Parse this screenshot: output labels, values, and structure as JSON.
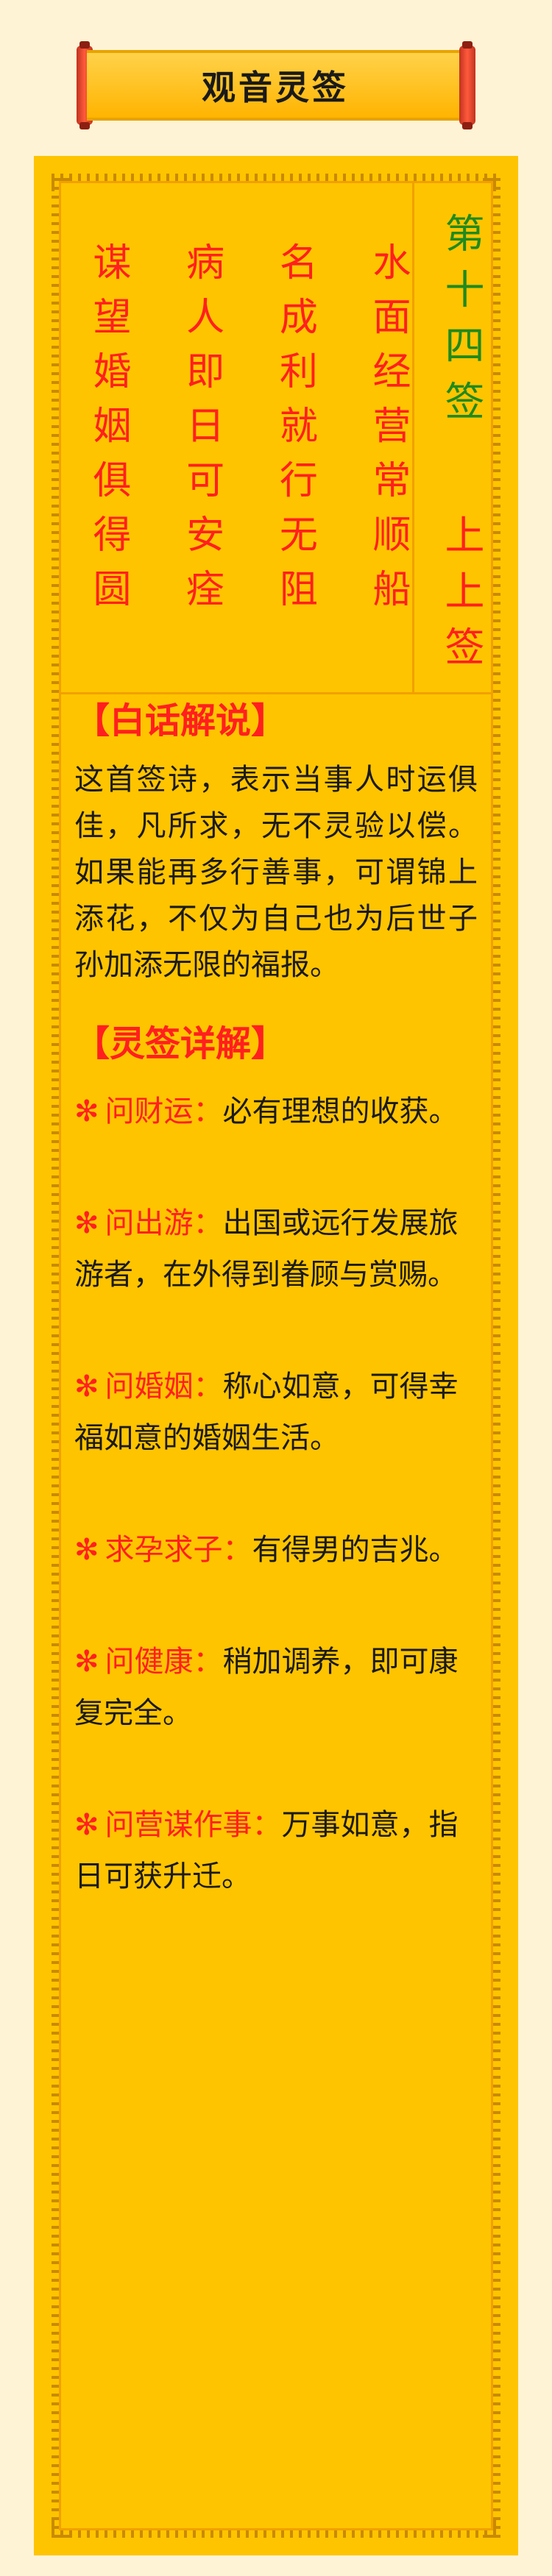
{
  "title": "观音灵签",
  "sign": {
    "number": "第十四签",
    "level": "上上签"
  },
  "poem": {
    "columns": [
      "水面经营常顺船",
      "名成利就行无阻",
      "病人即日可安痊",
      "谋望婚姻俱得圆"
    ]
  },
  "plain_explanation": {
    "heading": "【白话解说】",
    "text": "这首签诗，表示当事人时运俱佳，凡所求，无不灵验以偿。如果能再多行善事，可谓锦上添花，不仅为自己也为后世子孙加添无限的福报。"
  },
  "detail": {
    "heading": "【灵签详解】",
    "items": [
      {
        "key": "问财运：",
        "value": "必有理想的收获。"
      },
      {
        "key": "问出游：",
        "value": "出国或远行发展旅游者，在外得到眷顾与赏赐。"
      },
      {
        "key": "问婚姻：",
        "value": "称心如意，可得幸福如意的婚姻生活。"
      },
      {
        "key": "求孕求子：",
        "value": "有得男的吉兆。"
      },
      {
        "key": "问健康：",
        "value": "稍加调养，即可康复完全。"
      },
      {
        "key": "问营谋作事：",
        "value": "万事如意，指日可获升迁。"
      }
    ]
  },
  "colors": {
    "background": "#fef3d4",
    "panel": "#ffc400",
    "accent_red": "#ff1f1f",
    "accent_green": "#1f8a1f"
  }
}
